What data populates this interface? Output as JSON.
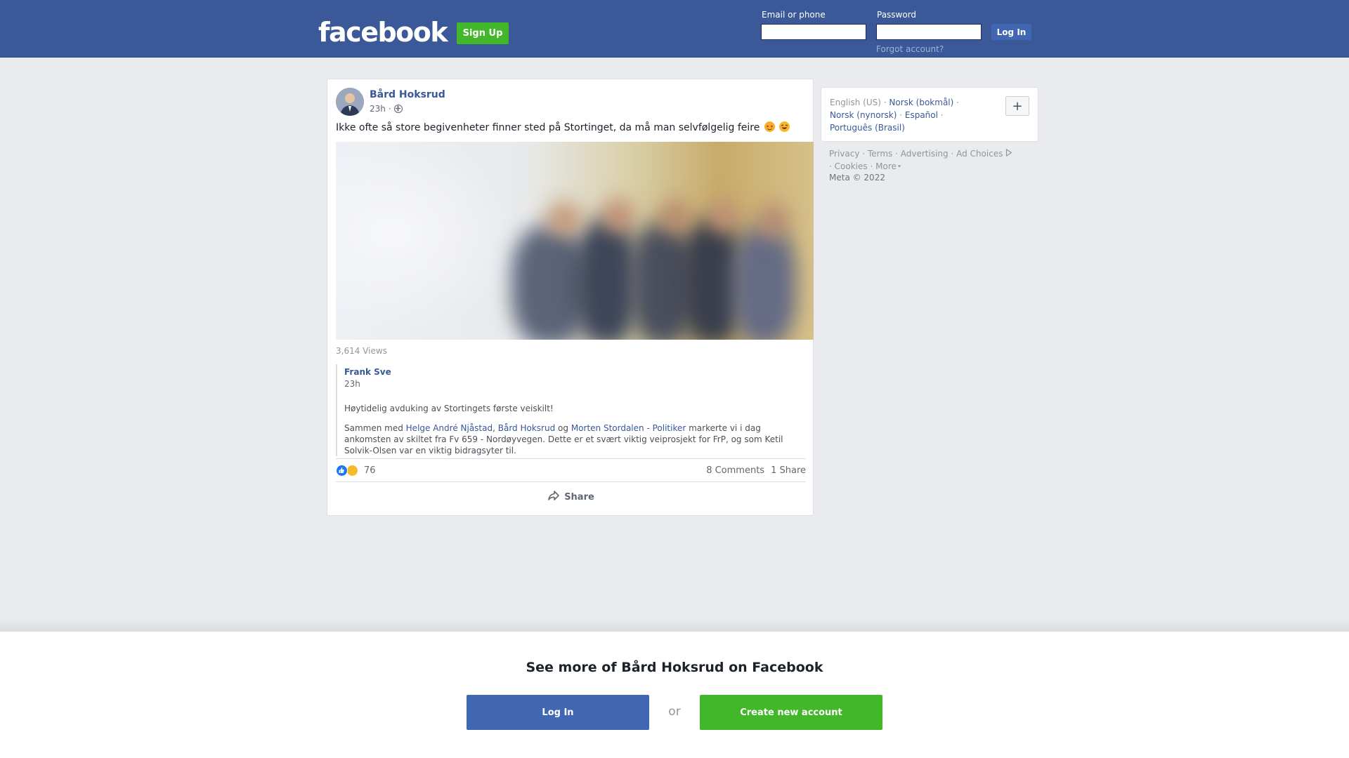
{
  "header": {
    "logo": "facebook",
    "signup_label": "Sign Up",
    "email_label": "Email or phone",
    "password_label": "Password",
    "login_label": "Log In",
    "forgot_label": "Forgot account?"
  },
  "post": {
    "author": "Bård Hoksrud",
    "time": "23h",
    "separator": "·",
    "privacy_icon": "globe-icon",
    "text": "Ikke ofte så store begivenheter finner sted på Stortinget, da må man selvfølgelig feire",
    "emojis": [
      "star-struck-emoji",
      "rofl-emoji"
    ],
    "views": "3,614 Views",
    "shared": {
      "author": "Frank Sve",
      "time": "23h",
      "headline": "Høytidelig avduking av Stortingets første veiskilt!",
      "body_prefix": "Sammen med ",
      "link1": "Helge André Njåstad",
      "sep1": ", ",
      "link2": "Bård Hoksrud",
      "sep2": " og ",
      "link3": "Morten Stordalen - Politiker",
      "body_suffix": " markerte vi i dag ankomsten av skiltet fra Fv 659 - Nordøyvegen. Dette er et svært viktig veiprosjekt for FrP, og som Ketil Solvik-Olsen var en viktig bidragsyter til."
    },
    "reaction_count": "76",
    "comments": "8 Comments",
    "shares": "1 Share",
    "share_label": "Share"
  },
  "sidebar": {
    "languages": {
      "current": "English (US)",
      "items": [
        "Norsk (bokmål)",
        "Norsk (nynorsk)",
        "Español",
        "Português (Brasil)"
      ]
    },
    "plus_label": "+",
    "footer": {
      "privacy": "Privacy",
      "terms": "Terms",
      "advertising": "Advertising",
      "ad_choices": "Ad Choices",
      "cookies": "Cookies",
      "more": "More",
      "dot": "·"
    },
    "copyright": "Meta © 2022"
  },
  "banner": {
    "title": "See more of Bård Hoksrud on Facebook",
    "login_label": "Log In",
    "or_label": "or",
    "create_label": "Create new account"
  },
  "colors": {
    "brand_blue": "#3b5998",
    "button_blue": "#4267b2",
    "green": "#42b72a",
    "link": "#385898"
  }
}
